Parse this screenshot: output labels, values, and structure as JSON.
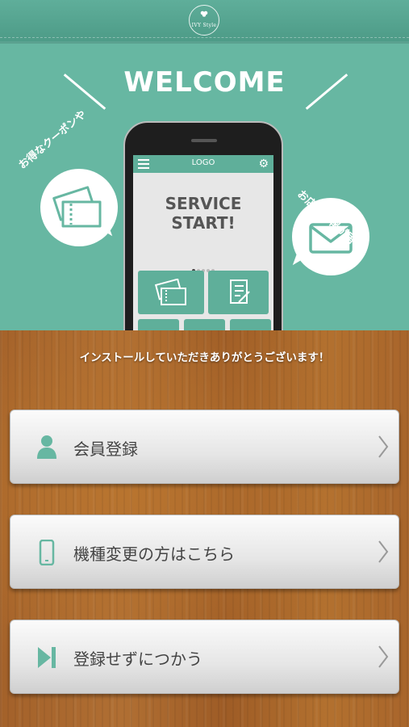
{
  "header": {
    "brand": "IVY Style"
  },
  "hero": {
    "welcome": "WELCOME",
    "coupon_caption": "お得なクーポンや",
    "info_caption": "お店の情報が届く!",
    "phone": {
      "logo": "LOGO",
      "title_line1": "SERVICE",
      "title_line2": "START!"
    }
  },
  "main": {
    "thanks": "インストールしていただきありがとうございます！",
    "buttons": [
      {
        "label": "会員登録",
        "icon": "person-icon"
      },
      {
        "label": "機種変更の方はこちら",
        "icon": "smartphone-icon"
      },
      {
        "label": "登録せずにつかう",
        "icon": "skip-icon"
      }
    ]
  },
  "colors": {
    "teal": "#67b7a2",
    "teal_dark": "#4c9a86",
    "button_text": "#444444"
  }
}
